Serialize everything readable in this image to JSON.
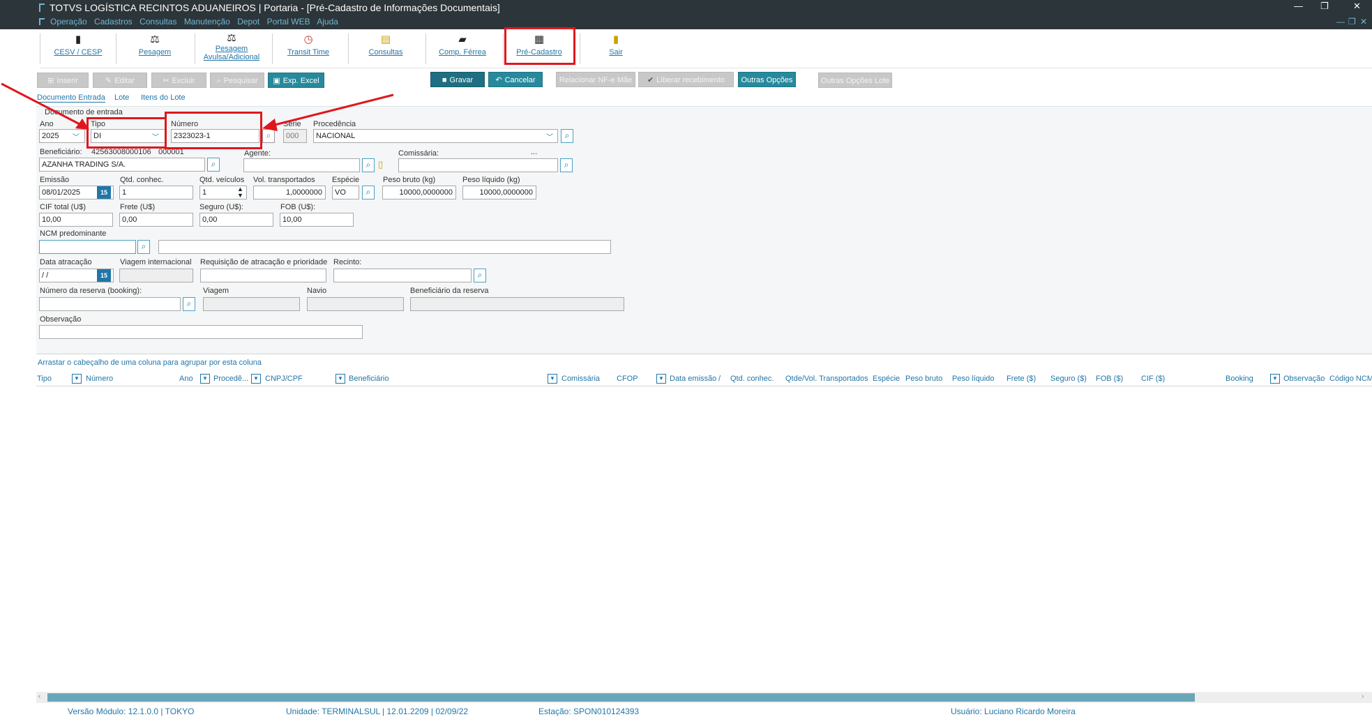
{
  "window": {
    "title": "TOTVS LOGÍSTICA RECINTOS ADUANEIROS | Portaria - [Pré-Cadastro de Informações Documentais]",
    "menu": [
      "Operação",
      "Cadastros",
      "Consultas",
      "Manutenção",
      "Depot",
      "Portal WEB",
      "Ajuda"
    ],
    "controls": {
      "minimize": "—",
      "restore": "❐",
      "close": "✕"
    },
    "mdi_controls": {
      "minimize": "—",
      "restore": "❐",
      "close": "✕"
    }
  },
  "toolbar": [
    {
      "label": "CESV / CESP",
      "icon": "traffic-light-icon"
    },
    {
      "label": "Pesagem",
      "icon": "scale-icon"
    },
    {
      "label": "Pesagem Avulsa/Adicional",
      "icon": "scale-extra-icon"
    },
    {
      "label": "Transit Time",
      "icon": "clock-icon"
    },
    {
      "label": "Consultas",
      "icon": "query-icon"
    },
    {
      "label": "Comp. Férrea",
      "icon": "train-icon"
    },
    {
      "label": "Pré-Cadastro",
      "icon": "pre-register-icon"
    },
    {
      "label": "Sair",
      "icon": "exit-icon"
    }
  ],
  "actions": {
    "inserir": "Inserir",
    "editar": "Editar",
    "excluir": "Excluir",
    "pesquisar": "Pesquisar",
    "exp_excel": "Exp. Excel",
    "gravar": "Gravar",
    "cancelar": "Cancelar",
    "relacionar": "Relacionar NF-e Mãe",
    "liberar": "Liberar recebimento",
    "outras": "Outras Opções",
    "outras_lote": "Outras Opções Lote"
  },
  "tabs": [
    "Documento Entrada",
    "Lote",
    "Itens do Lote"
  ],
  "form": {
    "group_title": "Documento de entrada",
    "ano": {
      "label": "Ano",
      "value": "2025"
    },
    "tipo": {
      "label": "Tipo",
      "value": "DI"
    },
    "numero": {
      "label": "Número",
      "value": "2323023-1"
    },
    "serie": {
      "label": "Série",
      "value": "000"
    },
    "procedencia": {
      "label": "Procedência",
      "value": "NACIONAL"
    },
    "beneficiario": {
      "label": "Beneficiário:",
      "cnpj": "42563008000106",
      "code": "000001",
      "value": "AZANHA TRADING S/A."
    },
    "agente": {
      "label": "Agente:",
      "value": ""
    },
    "comissaria": {
      "label": "Comissária:",
      "value": "",
      "ellipsis": "..."
    },
    "emissao": {
      "label": "Emissão",
      "value": "08/01/2025"
    },
    "qtd_conhec": {
      "label": "Qtd. conhec.",
      "value": "1"
    },
    "qtd_veiculos": {
      "label": "Qtd. veículos",
      "value": "1"
    },
    "vol_transportados": {
      "label": "Vol. transportados",
      "value": "1,0000000"
    },
    "especie": {
      "label": "Espécie",
      "value": "VO"
    },
    "peso_bruto": {
      "label": "Peso bruto (kg)",
      "value": "10000,0000000"
    },
    "peso_liquido": {
      "label": "Peso líquido (kg)",
      "value": "10000,0000000"
    },
    "cif_total": {
      "label": "CIF total (U$)",
      "value": "10,00"
    },
    "frete": {
      "label": "Frete (U$)",
      "value": "0,00"
    },
    "seguro": {
      "label": "Seguro (U$):",
      "value": "0,00"
    },
    "fob": {
      "label": "FOB (U$):",
      "value": "10,00"
    },
    "ncm": {
      "label": "NCM predominante",
      "value": "",
      "desc": ""
    },
    "data_atracacao": {
      "label": "Data atracação",
      "value": " /  /"
    },
    "viagem_internacional": {
      "label": "Viagem internacional",
      "value": ""
    },
    "requisicao": {
      "label": "Requisição de atracação e prioridade",
      "value": ""
    },
    "recinto": {
      "label": "Recinto:",
      "value": ""
    },
    "reserva": {
      "label": "Número da reserva (booking):",
      "value": ""
    },
    "viagem": {
      "label": "Viagem",
      "value": ""
    },
    "navio": {
      "label": "Navio",
      "value": ""
    },
    "benef_reserva": {
      "label": "Beneficiário da reserva",
      "value": ""
    },
    "observacao": {
      "label": "Observação",
      "value": ""
    },
    "calendar_label": "15"
  },
  "grid": {
    "group_hint": "Arrastar o cabeçalho de uma coluna para agrupar por esta coluna",
    "columns": [
      "Tipo",
      "Número",
      "Ano",
      "Procedê...",
      "CNPJ/CPF",
      "Beneficiário",
      "Comissária",
      "CFOP",
      "Data emissão",
      "Qtd. conhec.",
      "Qtde/Vol. Transportados",
      "Espécie",
      "Peso bruto",
      "Peso líquido",
      "Frete ($)",
      "Seguro ($)",
      "FOB ($)",
      "CIF ($)",
      "Booking",
      "Observação",
      "Código NCM"
    ],
    "sort_indicator": "/"
  },
  "status": {
    "versao": "Versão Módulo:  12.1.0.0  |  TOKYO",
    "unidade": "Unidade: TERMINALSUL | 12.01.2209 | 02/09/22",
    "estacao": "Estação: SPON010124393",
    "usuario": "Usuário: Luciano Ricardo Moreira"
  },
  "colors": {
    "accent": "#2176a8",
    "titlebar": "#2c3539",
    "annotation": "#e0161e",
    "teal_button": "#27899c"
  }
}
